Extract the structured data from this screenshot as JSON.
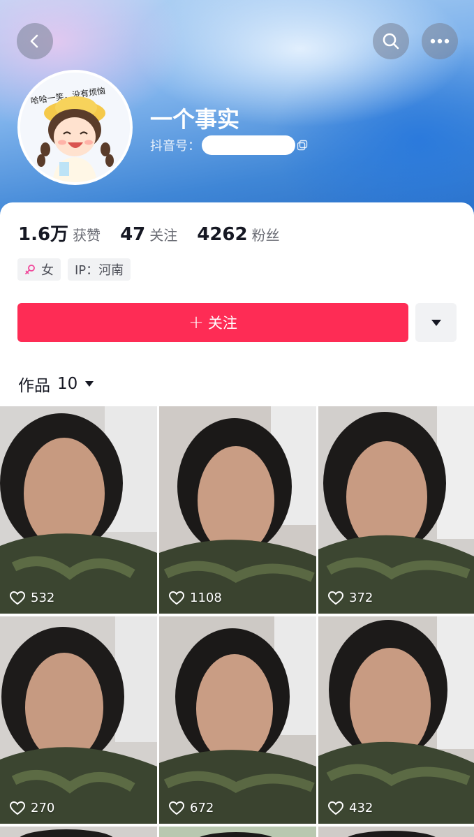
{
  "header": {
    "username": "一个事实",
    "douyin_id_label": "抖音号：",
    "avatar_caption": "哈哈一笑，没有烦恼"
  },
  "stats": [
    {
      "value": "1.6万",
      "label": "获赞"
    },
    {
      "value": "47",
      "label": "关注"
    },
    {
      "value": "4262",
      "label": "粉丝"
    }
  ],
  "tags": {
    "gender": "女",
    "ip": "IP：河南"
  },
  "actions": {
    "follow_label": "关注",
    "follow_plus": "+"
  },
  "works": {
    "label": "作品",
    "count": "10"
  },
  "videos": [
    {
      "likes": "532"
    },
    {
      "likes": "1108"
    },
    {
      "likes": "372"
    },
    {
      "likes": "270"
    },
    {
      "likes": "672"
    },
    {
      "likes": "432"
    }
  ],
  "colors": {
    "accent": "#fe2c55",
    "gender_icon": "#f0479a"
  }
}
